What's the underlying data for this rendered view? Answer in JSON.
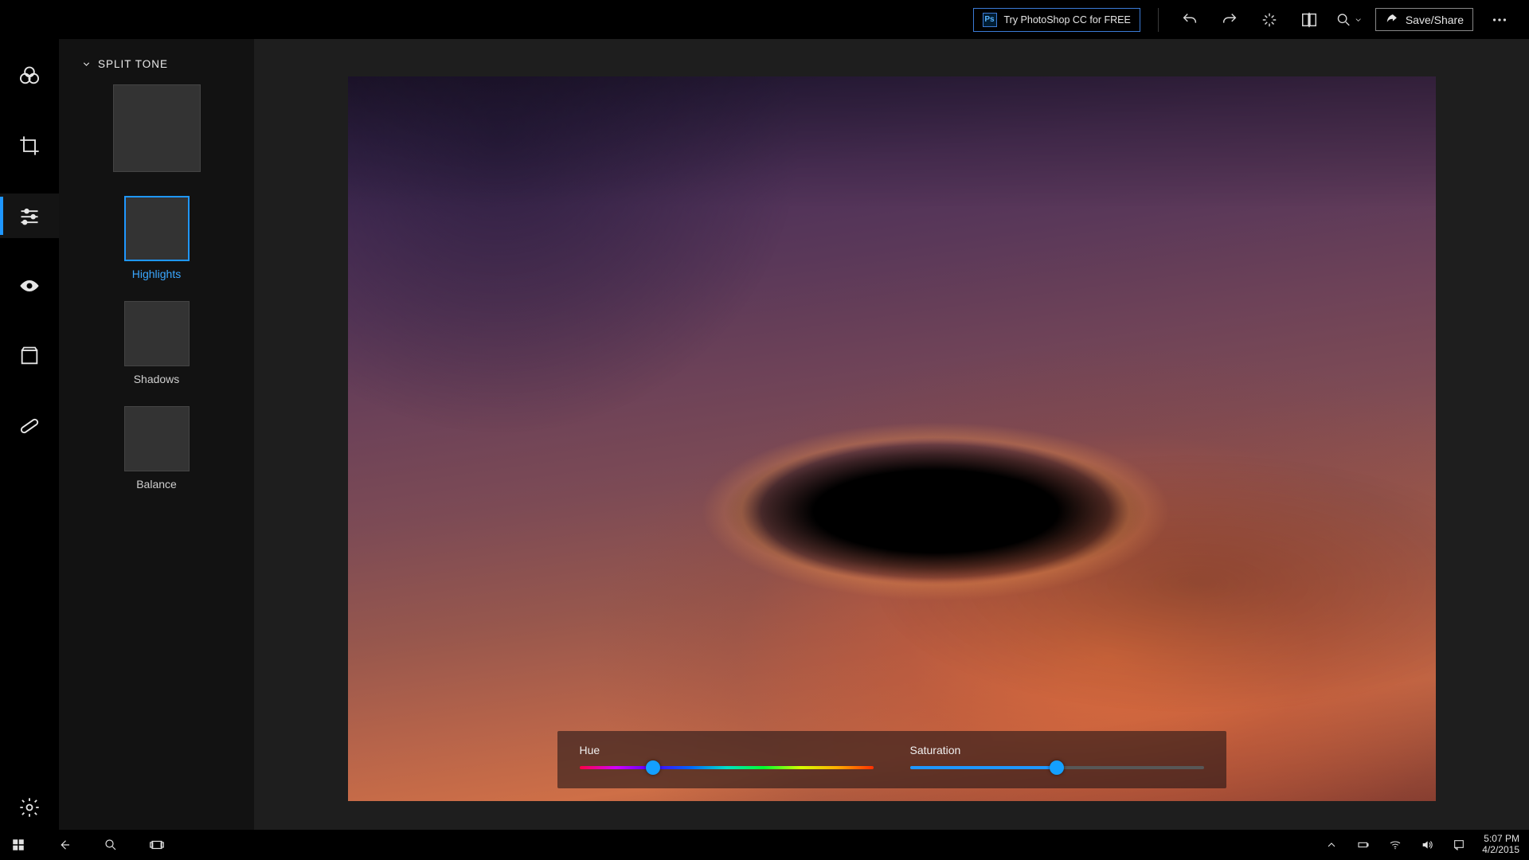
{
  "topbar": {
    "promo_label": "Try PhotoShop CC for FREE",
    "promo_badge": "Ps",
    "save_share_label": "Save/Share"
  },
  "panel": {
    "heading": "SPLIT TONE",
    "presets": [
      {
        "label": "",
        "thumb": "skyscraper",
        "size": "big",
        "selected": false
      },
      {
        "label": "Highlights",
        "thumb": "highlights",
        "size": "small",
        "selected": true
      },
      {
        "label": "Shadows",
        "thumb": "shadows",
        "size": "small",
        "selected": false
      },
      {
        "label": "Balance",
        "thumb": "balance",
        "size": "small",
        "selected": false
      }
    ]
  },
  "sliders": {
    "hue": {
      "label": "Hue",
      "value_pct": 25
    },
    "saturation": {
      "label": "Saturation",
      "value_pct": 50
    }
  },
  "taskbar": {
    "time": "5:07 PM",
    "date": "4/2/2015"
  },
  "icons": {
    "undo": "undo-icon",
    "redo": "redo-icon",
    "autofix": "sparkle-icon",
    "compare": "compare-icon",
    "zoom": "zoom-icon",
    "share": "share-icon",
    "more": "more-icon",
    "tool_looks": "looks-icon",
    "tool_crop": "crop-icon",
    "tool_adjust": "sliders-icon",
    "tool_redeye": "eye-icon",
    "tool_frames": "frame-icon",
    "tool_heal": "bandage-icon",
    "tool_settings": "gear-icon",
    "tb_start": "windows-icon",
    "tb_back": "back-icon",
    "tb_search": "search-icon",
    "tb_taskview": "taskview-icon",
    "tb_up": "chevron-up-icon",
    "tb_battery": "battery-icon",
    "tb_wifi": "wifi-icon",
    "tb_vol": "volume-icon",
    "tb_notif": "notification-icon"
  }
}
